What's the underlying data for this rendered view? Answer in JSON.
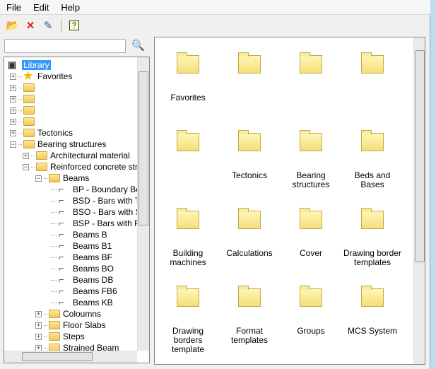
{
  "menu": [
    "File",
    "Edit",
    "Help"
  ],
  "toolbar": {
    "new_icon": "new-folder-icon",
    "delete_icon": "delete-icon",
    "edit_icon": "edit-icon",
    "help_icon": "help-icon"
  },
  "search": {
    "value": "",
    "placeholder": ""
  },
  "tree": [
    {
      "label": "Library",
      "level": 0,
      "type": "root",
      "selected": true
    },
    {
      "label": "Favorites",
      "level": 0,
      "type": "star",
      "exp": "+"
    },
    {
      "label": "",
      "level": 0,
      "type": "folder",
      "exp": "+"
    },
    {
      "label": "",
      "level": 0,
      "type": "folder",
      "exp": "+"
    },
    {
      "label": "",
      "level": 0,
      "type": "folder",
      "exp": "+"
    },
    {
      "label": "",
      "level": 0,
      "type": "folder",
      "exp": "+"
    },
    {
      "label": " Tectonics",
      "level": 0,
      "type": "folder",
      "exp": "+"
    },
    {
      "label": "Bearing structures",
      "level": 0,
      "type": "folder",
      "exp": "−"
    },
    {
      "label": "Architectural material",
      "level": 1,
      "type": "folder",
      "exp": "+"
    },
    {
      "label": "Reinforced concrete structures",
      "level": 1,
      "type": "folder",
      "exp": "−"
    },
    {
      "label": "Beams",
      "level": 2,
      "type": "folder",
      "exp": "−"
    },
    {
      "label": "BP - Boundary Beams",
      "level": 3,
      "type": "beam"
    },
    {
      "label": "BSD - Bars with Two",
      "level": 3,
      "type": "beam"
    },
    {
      "label": "BSO - Bars with Slope",
      "level": 3,
      "type": "beam"
    },
    {
      "label": "BSP - Bars with Parallel",
      "level": 3,
      "type": "beam"
    },
    {
      "label": "Beams B",
      "level": 3,
      "type": "beam"
    },
    {
      "label": "Beams B1",
      "level": 3,
      "type": "beam"
    },
    {
      "label": "Beams BF",
      "level": 3,
      "type": "beam"
    },
    {
      "label": "Beams BO",
      "level": 3,
      "type": "beam"
    },
    {
      "label": "Beams DB",
      "level": 3,
      "type": "beam"
    },
    {
      "label": "Beams FB6",
      "level": 3,
      "type": "beam"
    },
    {
      "label": "Beams KB",
      "level": 3,
      "type": "beam"
    },
    {
      "label": "Coloumns",
      "level": 2,
      "type": "folder",
      "exp": "+"
    },
    {
      "label": "Floor Slabs",
      "level": 2,
      "type": "folder",
      "exp": "+"
    },
    {
      "label": "Steps",
      "level": 2,
      "type": "folder",
      "exp": "+"
    },
    {
      "label": "Strained Beam",
      "level": 2,
      "type": "folder",
      "exp": "+"
    }
  ],
  "items": [
    "Favorites",
    "",
    "",
    "",
    "",
    "Tectonics",
    "Bearing structures",
    "Beds and Bases",
    "Building machines",
    "Calculations",
    "Cover",
    "Drawing border templates",
    "Drawing borders template",
    "Format templates",
    "Groups",
    "MCS System"
  ]
}
